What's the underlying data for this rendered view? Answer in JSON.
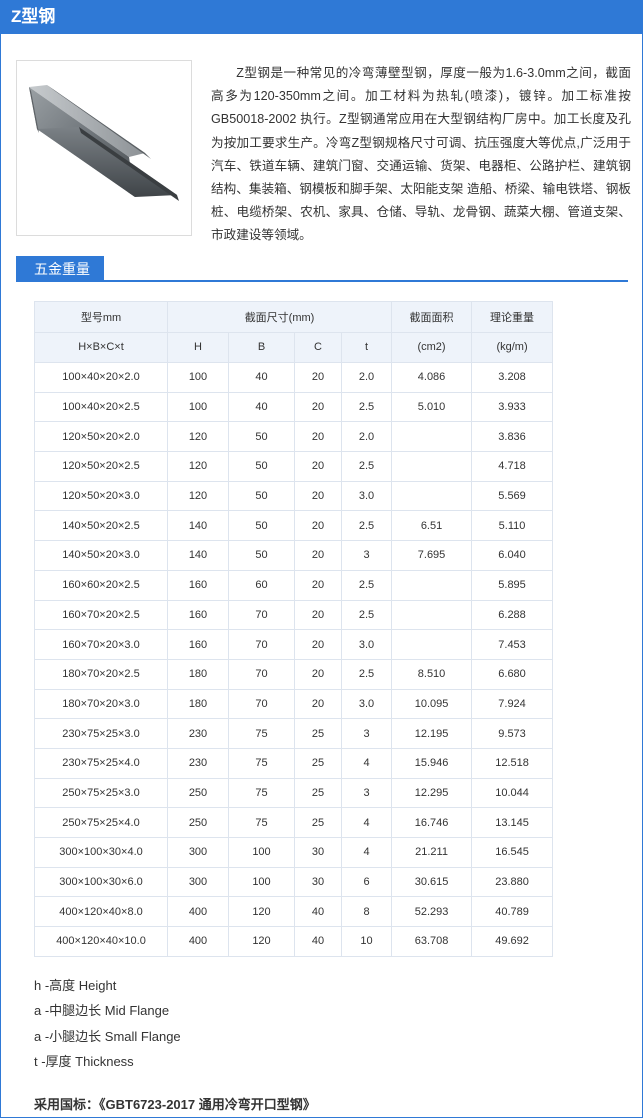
{
  "header": {
    "title": "Z型钢"
  },
  "product": {
    "image_name": "z-section-steel",
    "description": "Z型钢是一种常见的冷弯薄壁型钢，厚度一般为1.6-3.0mm之间，截面高多为120-350mm之间。加工材料为热轧(喷漆)，镀锌。加工标准按GB50018-2002 执行。Z型钢通常应用在大型钢结构厂房中。加工长度及孔为按加工要求生产。冷弯Z型钢规格尺寸可调、抗压强度大等优点,广泛用于汽车、铁道车辆、建筑门窗、交通运输、货架、电器柜、公路护栏、建筑钢结构、集装箱、钢模板和脚手架、太阳能支架 造船、桥梁、输电铁塔、钢板桩、电缆桥架、农机、家具、仓储、导轨、龙骨钢、蔬菜大棚、管道支架、市政建设等领域。"
  },
  "section": {
    "title": "五金重量"
  },
  "table": {
    "header_row1": {
      "model": "型号mm",
      "dims": "截面尺寸(mm)",
      "area": "截面面积",
      "weight": "理论重量"
    },
    "header_row2": {
      "model": "H×B×C×t",
      "h": "H",
      "b": "B",
      "c": "C",
      "t": "t",
      "area_unit": "(cm2)",
      "weight_unit": "(kg/m)"
    },
    "rows": [
      [
        "100×40×20×2.0",
        "100",
        "40",
        "20",
        "2.0",
        "4.086",
        "3.208"
      ],
      [
        "100×40×20×2.5",
        "100",
        "40",
        "20",
        "2.5",
        "5.010",
        "3.933"
      ],
      [
        "120×50×20×2.0",
        "120",
        "50",
        "20",
        "2.0",
        "",
        "3.836"
      ],
      [
        "120×50×20×2.5",
        "120",
        "50",
        "20",
        "2.5",
        "",
        "4.718"
      ],
      [
        "120×50×20×3.0",
        "120",
        "50",
        "20",
        "3.0",
        "",
        "5.569"
      ],
      [
        "140×50×20×2.5",
        "140",
        "50",
        "20",
        "2.5",
        "6.51",
        "5.110"
      ],
      [
        "140×50×20×3.0",
        "140",
        "50",
        "20",
        "3",
        "7.695",
        "6.040"
      ],
      [
        "160×60×20×2.5",
        "160",
        "60",
        "20",
        "2.5",
        "",
        "5.895"
      ],
      [
        "160×70×20×2.5",
        "160",
        "70",
        "20",
        "2.5",
        "",
        "6.288"
      ],
      [
        "160×70×20×3.0",
        "160",
        "70",
        "20",
        "3.0",
        "",
        "7.453"
      ],
      [
        "180×70×20×2.5",
        "180",
        "70",
        "20",
        "2.5",
        "8.510",
        "6.680"
      ],
      [
        "180×70×20×3.0",
        "180",
        "70",
        "20",
        "3.0",
        "10.095",
        "7.924"
      ],
      [
        "230×75×25×3.0",
        "230",
        "75",
        "25",
        "3",
        "12.195",
        "9.573"
      ],
      [
        "230×75×25×4.0",
        "230",
        "75",
        "25",
        "4",
        "15.946",
        "12.518"
      ],
      [
        "250×75×25×3.0",
        "250",
        "75",
        "25",
        "3",
        "12.295",
        "10.044"
      ],
      [
        "250×75×25×4.0",
        "250",
        "75",
        "25",
        "4",
        "16.746",
        "13.145"
      ],
      [
        "300×100×30×4.0",
        "300",
        "100",
        "30",
        "4",
        "21.211",
        "16.545"
      ],
      [
        "300×100×30×6.0",
        "300",
        "100",
        "30",
        "6",
        "30.615",
        "23.880"
      ],
      [
        "400×120×40×8.0",
        "400",
        "120",
        "40",
        "8",
        "52.293",
        "40.789"
      ],
      [
        "400×120×40×10.0",
        "400",
        "120",
        "40",
        "10",
        "63.708",
        "49.692"
      ]
    ]
  },
  "notes": [
    "h -高度 Height",
    "a -中腿边长 Mid Flange",
    "a -小腿边长 Small Flange",
    "t -厚度 Thickness"
  ],
  "standard": {
    "label": "采用国标：",
    "value": "《GBT6723-2017 通用冷弯开口型钢》"
  },
  "colors": {
    "accent": "#2f79d6",
    "header_bg": "#eef3fa",
    "border": "#dde4ee"
  }
}
